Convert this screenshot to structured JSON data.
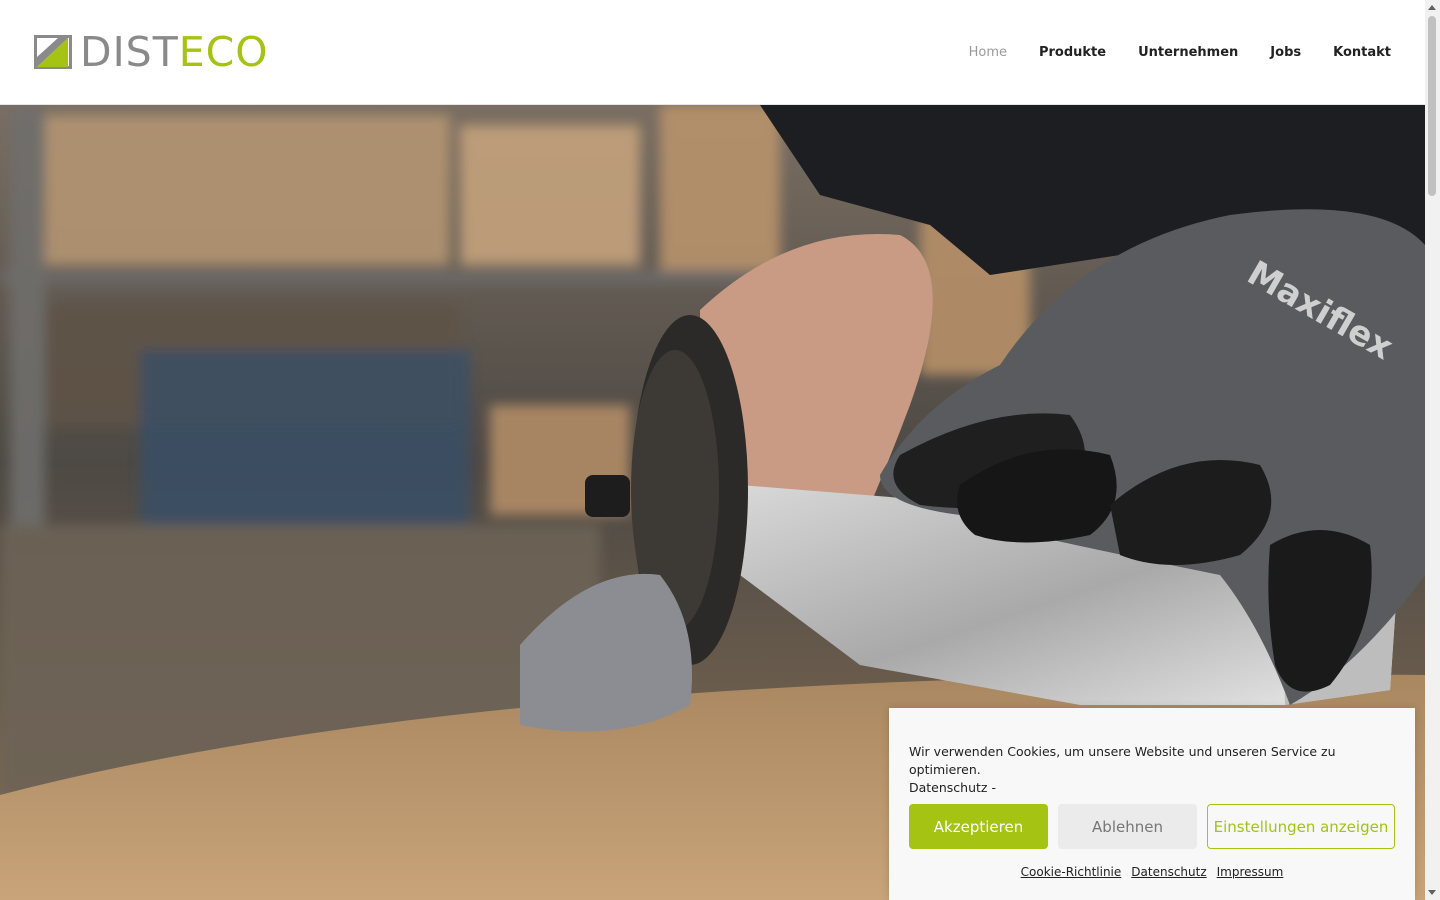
{
  "brand": {
    "logo_part1": "DIST",
    "logo_part2": "ECO",
    "accent_color": "#a4c312",
    "gray_color": "#8a8a8a"
  },
  "nav": {
    "items": [
      {
        "label": "Home",
        "active": true
      },
      {
        "label": "Produkte",
        "active": false
      },
      {
        "label": "Unternehmen",
        "active": false
      },
      {
        "label": "Jobs",
        "active": false
      },
      {
        "label": "Kontakt",
        "active": false
      }
    ]
  },
  "hero": {
    "image_description": "",
    "glove_text": "Maxiflex"
  },
  "cookie": {
    "message": "Wir verwenden Cookies, um unsere Website und unseren Service zu optimieren.",
    "message_link": "Datenschutz -",
    "accept_label": "Akzeptieren",
    "deny_label": "Ablehnen",
    "settings_label": "Einstellungen anzeigen",
    "links": [
      "Cookie-Richtlinie",
      "Datenschutz",
      "Impressum"
    ]
  }
}
